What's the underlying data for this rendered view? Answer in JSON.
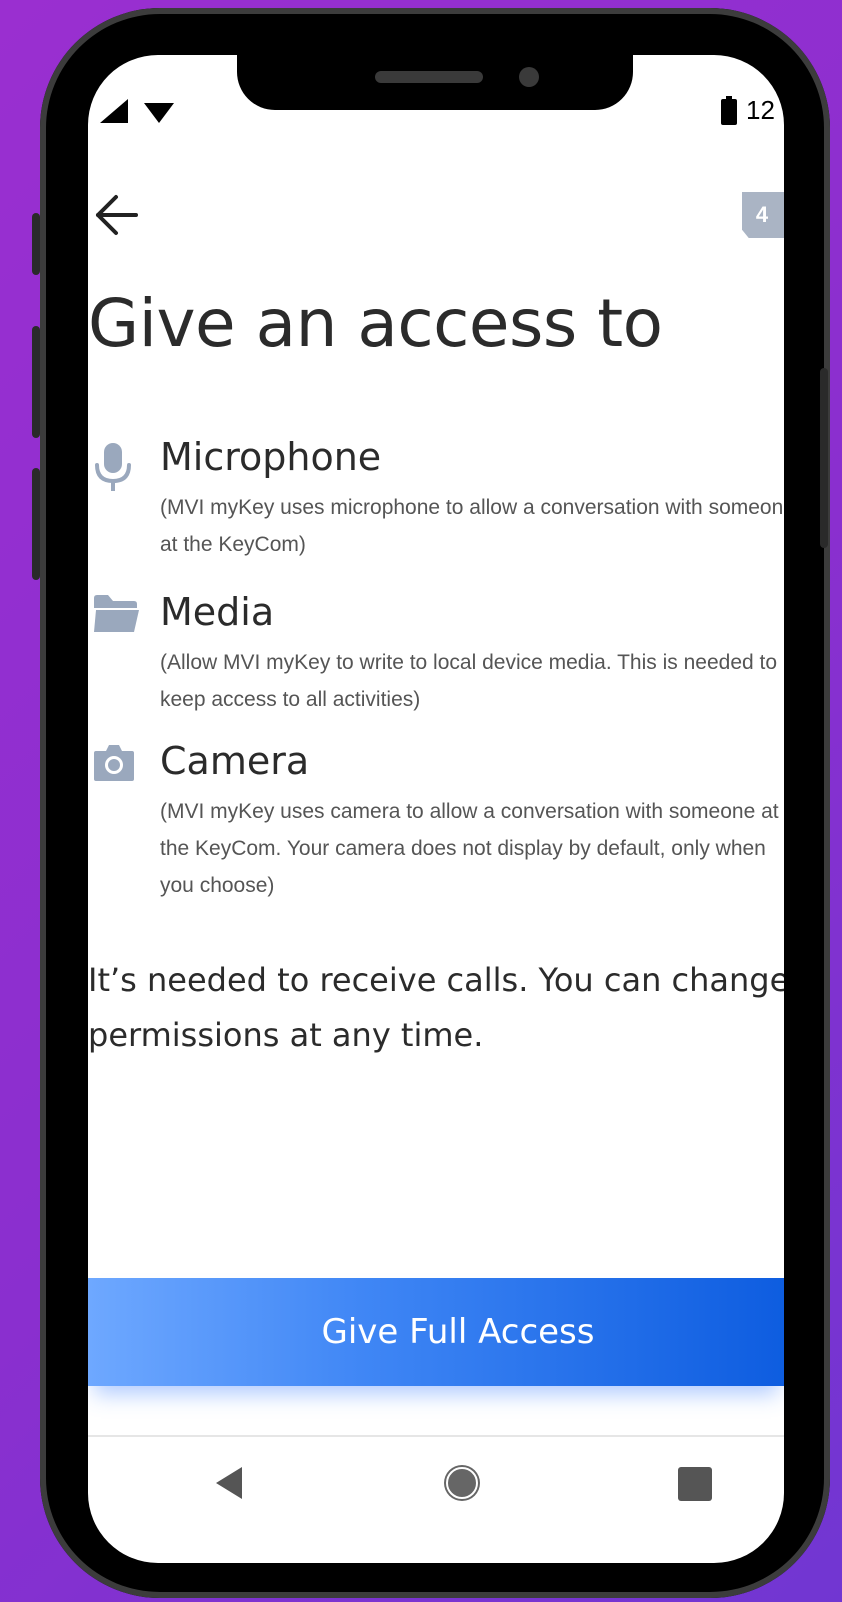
{
  "status_bar": {
    "time": "12",
    "step": "4"
  },
  "header": {
    "title": "Give an access to"
  },
  "permissions": [
    {
      "name": "Microphone",
      "icon": "microphone-icon",
      "description": "(MVI myKey uses microphone to allow a conversation with someone at the KeyCom)"
    },
    {
      "name": "Media",
      "icon": "folder-icon",
      "description": "(Allow MVI myKey to write to local device media. This is needed to keep access to all activities)"
    },
    {
      "name": "Camera",
      "icon": "camera-icon",
      "description": "(MVI myKey uses camera to allow a conversation with someone at the KeyCom. Your camera does not display by default, only when you choose)"
    }
  ],
  "note": "It’s needed to receive calls. You can change permissions at any time.",
  "cta": {
    "label": "Give Full Access"
  },
  "colors": {
    "accent": "#2f78f0",
    "icon": "#9aa8bd",
    "background": "#8b2fcf"
  }
}
